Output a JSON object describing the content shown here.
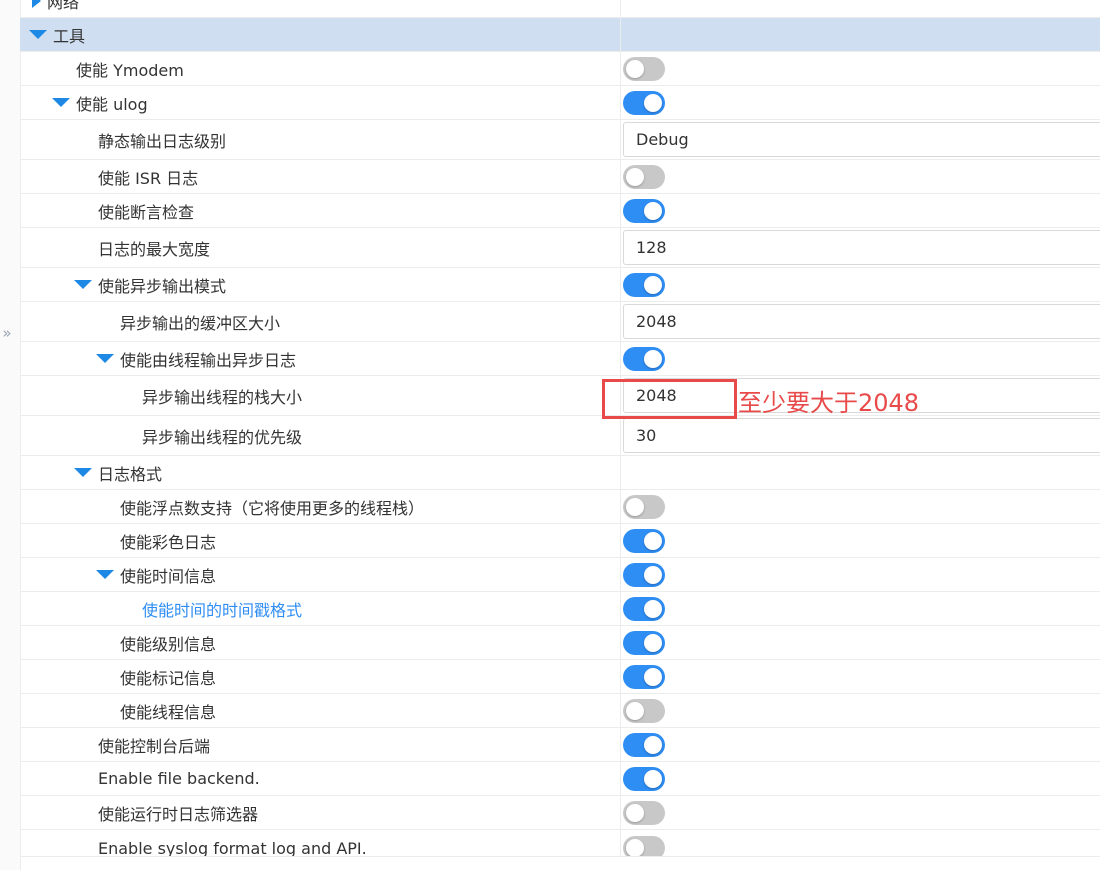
{
  "rows": [
    {
      "label": "网络",
      "kind": "none",
      "caret": "right"
    },
    {
      "label": "工具",
      "kind": "none",
      "caret": "down"
    },
    {
      "label": "使能 Ymodem",
      "kind": "toggle",
      "on": false
    },
    {
      "label": "使能 ulog",
      "kind": "toggle",
      "on": true,
      "caret": "down"
    },
    {
      "label": "静态输出日志级别",
      "kind": "field",
      "value": "Debug"
    },
    {
      "label": "使能 ISR 日志",
      "kind": "toggle",
      "on": false
    },
    {
      "label": "使能断言检查",
      "kind": "toggle",
      "on": true
    },
    {
      "label": "日志的最大宽度",
      "kind": "field",
      "value": "128"
    },
    {
      "label": "使能异步输出模式",
      "kind": "toggle",
      "on": true,
      "caret": "down"
    },
    {
      "label": "异步输出的缓冲区大小",
      "kind": "field",
      "value": "2048"
    },
    {
      "label": "使能由线程输出异步日志",
      "kind": "toggle",
      "on": true,
      "caret": "down"
    },
    {
      "label": "异步输出线程的栈大小",
      "kind": "field",
      "value": "2048"
    },
    {
      "label": "异步输出线程的优先级",
      "kind": "field",
      "value": "30"
    },
    {
      "label": "日志格式",
      "kind": "none",
      "caret": "down"
    },
    {
      "label": "使能浮点数支持（它将使用更多的线程栈）",
      "kind": "toggle",
      "on": false
    },
    {
      "label": "使能彩色日志",
      "kind": "toggle",
      "on": true
    },
    {
      "label": "使能时间信息",
      "kind": "toggle",
      "on": true,
      "caret": "down"
    },
    {
      "label": "使能时间的时间戳格式",
      "kind": "toggle",
      "on": true
    },
    {
      "label": "使能级别信息",
      "kind": "toggle",
      "on": true
    },
    {
      "label": "使能标记信息",
      "kind": "toggle",
      "on": true
    },
    {
      "label": "使能线程信息",
      "kind": "toggle",
      "on": false
    },
    {
      "label": "使能控制台后端",
      "kind": "toggle",
      "on": true
    },
    {
      "label": "Enable file backend.",
      "kind": "toggle",
      "on": true
    },
    {
      "label": "使能运行时日志筛选器",
      "kind": "toggle",
      "on": false
    },
    {
      "label": "Enable syslog format log and API.",
      "kind": "toggle",
      "on": false
    }
  ],
  "annotation": {
    "text": "至少要大于2048"
  },
  "colors": {
    "accent": "#2f8ef4",
    "highlight": "#cfdef0",
    "annotation": "#e84a4a",
    "toggle_off": "#c8c8c8"
  }
}
